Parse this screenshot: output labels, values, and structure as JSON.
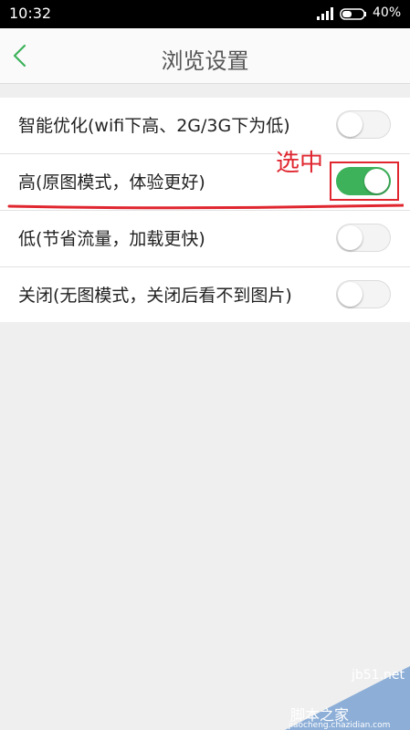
{
  "status_bar": {
    "time": "10:32",
    "battery": "40%"
  },
  "header": {
    "title": "浏览设置",
    "back_icon": "chevron-left-icon",
    "accent_color": "#3db25a"
  },
  "settings": [
    {
      "label": "智能优化(wifi下高、2G/3G下为低)",
      "enabled": false
    },
    {
      "label": "高(原图模式，体验更好)",
      "enabled": true
    },
    {
      "label": "低(节省流量，加载更快)",
      "enabled": false
    },
    {
      "label": "关闭(无图模式，关闭后看不到图片)",
      "enabled": false
    }
  ],
  "annotation": {
    "text": "选中",
    "color": "#e0262f"
  },
  "watermark": {
    "site": "jb51.net",
    "brand": "脚本之家",
    "url": "jiaocheng.chazidian.com"
  }
}
